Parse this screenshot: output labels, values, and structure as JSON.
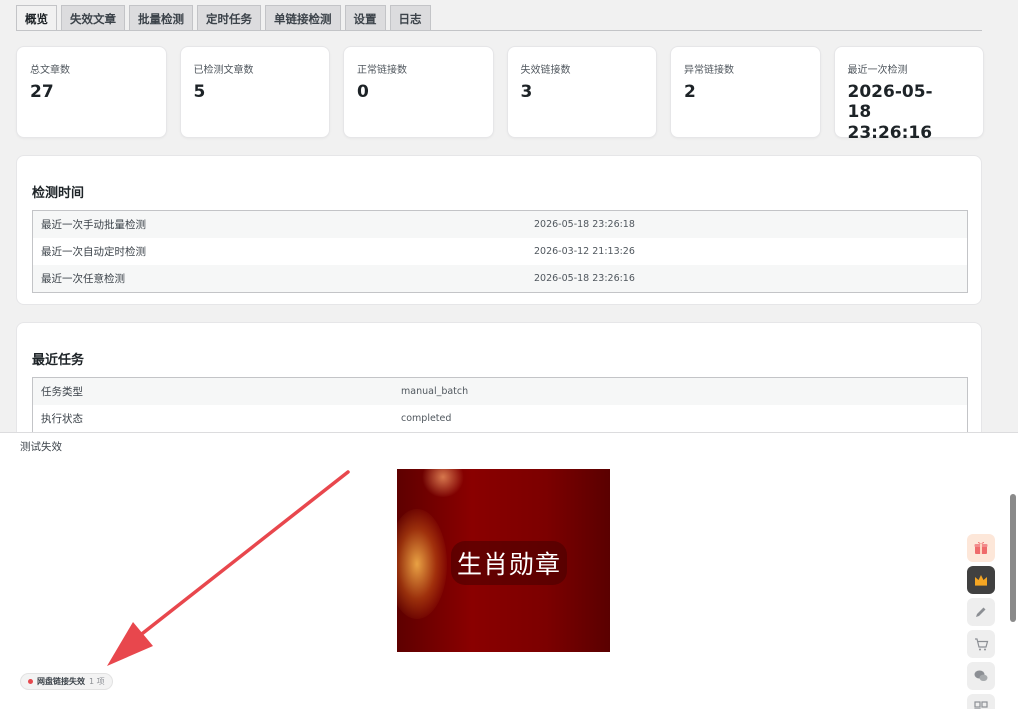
{
  "tabs": [
    {
      "label": "概览",
      "active": true
    },
    {
      "label": "失效文章"
    },
    {
      "label": "批量检测"
    },
    {
      "label": "定时任务"
    },
    {
      "label": "单链接检测"
    },
    {
      "label": "设置"
    },
    {
      "label": "日志"
    }
  ],
  "stats": [
    {
      "label": "总文章数",
      "value": "27"
    },
    {
      "label": "已检测文章数",
      "value": "5"
    },
    {
      "label": "正常链接数",
      "value": "0"
    },
    {
      "label": "失效链接数",
      "value": "3"
    },
    {
      "label": "异常链接数",
      "value": "2"
    },
    {
      "label": "最近一次检测",
      "value": "2026-05-18 23:26:16"
    }
  ],
  "check_time": {
    "title": "检测时间",
    "rows": [
      {
        "key": "最近一次手动批量检测",
        "value": "2026-05-18 23:26:18"
      },
      {
        "key": "最近一次自动定时检测",
        "value": "2026-03-12 21:13:26"
      },
      {
        "key": "最近一次任意检测",
        "value": "2026-05-18 23:26:16"
      }
    ]
  },
  "recent_task": {
    "title": "最近任务",
    "rows": [
      {
        "key": "任务类型",
        "value": "manual_batch"
      },
      {
        "key": "执行状态",
        "value": "completed"
      }
    ]
  },
  "bottom": {
    "label": "测试失效",
    "image_caption": "生肖勋章",
    "chip_text": "网盘链接失效",
    "chip_count": "1 项"
  },
  "colors": {
    "arrow": "#e8474d",
    "thumb_red": "#8a0000",
    "chip_dot": "#e5484d"
  },
  "toolbar_icons": [
    "gift-icon",
    "crown-icon",
    "pencil-icon",
    "cart-icon",
    "wechat-icon",
    "qrcode-icon"
  ]
}
